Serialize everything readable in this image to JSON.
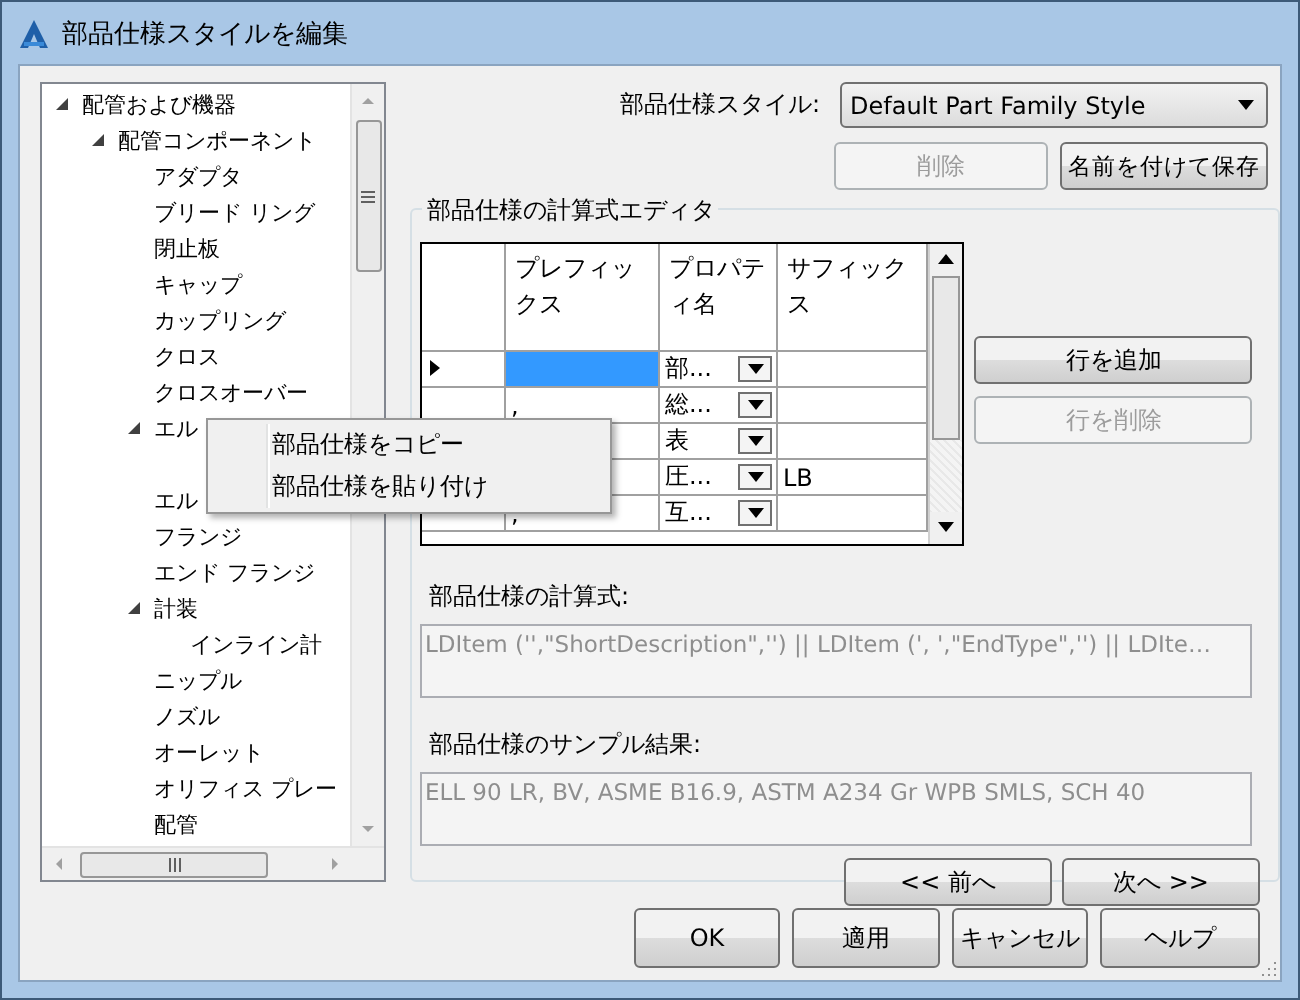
{
  "window": {
    "title": "部品仕様スタイルを編集"
  },
  "tree": {
    "items": [
      {
        "label": "配管および機器",
        "expanded": true,
        "children": [
          {
            "label": "配管コンポーネント",
            "expanded": true,
            "children": [
              {
                "label": "アダプタ"
              },
              {
                "label": "ブリード リング"
              },
              {
                "label": "閉止板"
              },
              {
                "label": "キャップ"
              },
              {
                "label": "カップリング"
              },
              {
                "label": "クロス"
              },
              {
                "label": "クロスオーバー"
              },
              {
                "label": "エル",
                "expanded": true
              },
              {
                "label": "エル"
              },
              {
                "label": "フランジ"
              },
              {
                "label": "エンド フランジ"
              },
              {
                "label": "計装",
                "expanded": true,
                "children": [
                  {
                    "label": "インライン計"
                  }
                ]
              },
              {
                "label": "ニップル"
              },
              {
                "label": "ノズル"
              },
              {
                "label": "オーレット"
              },
              {
                "label": "オリフィス プレー"
              },
              {
                "label": "配管"
              }
            ]
          }
        ]
      }
    ]
  },
  "context_menu": {
    "items": [
      "部品仕様をコピー",
      "部品仕様を貼り付け"
    ]
  },
  "style_label": "部品仕様スタイル:",
  "style_dropdown": {
    "value": "Default Part Family Style"
  },
  "style_buttons": [
    {
      "label": "削除",
      "disabled": true
    },
    {
      "label": "名前を付けて保存",
      "disabled": false
    }
  ],
  "editor": {
    "title": "部品仕様の計算式エディタ",
    "columns": [
      "プレフィックス",
      "プロパティ名",
      "サフィックス"
    ],
    "rows": [
      {
        "selected": true,
        "prefix": "",
        "property": "部...",
        "suffix": ""
      },
      {
        "selected": false,
        "prefix": ",",
        "property": "総...",
        "suffix": ""
      },
      {
        "selected": false,
        "prefix": "",
        "property": "表",
        "suffix": ""
      },
      {
        "selected": false,
        "prefix": "",
        "property": "圧...",
        "suffix": "LB"
      },
      {
        "selected": false,
        "prefix": ",",
        "property": "互...",
        "suffix": ""
      }
    ],
    "row_buttons": [
      {
        "label": "行を追加",
        "disabled": false
      },
      {
        "label": "行を削除",
        "disabled": true
      }
    ],
    "formula_label": "部品仕様の計算式:",
    "formula": "LDItem ('',\"ShortDescription\",'') || LDItem (', ',\"EndType\",'') || LDIte…",
    "sample_label": "部品仕様のサンプル結果:",
    "sample": "ELL 90 LR, BV, ASME B16.9, ASTM A234 Gr WPB SMLS, SCH 40",
    "nav_buttons": [
      "<< 前へ",
      "次へ >>"
    ]
  },
  "buttons": [
    "OK",
    "適用",
    "キャンセル",
    "ヘルプ"
  ]
}
